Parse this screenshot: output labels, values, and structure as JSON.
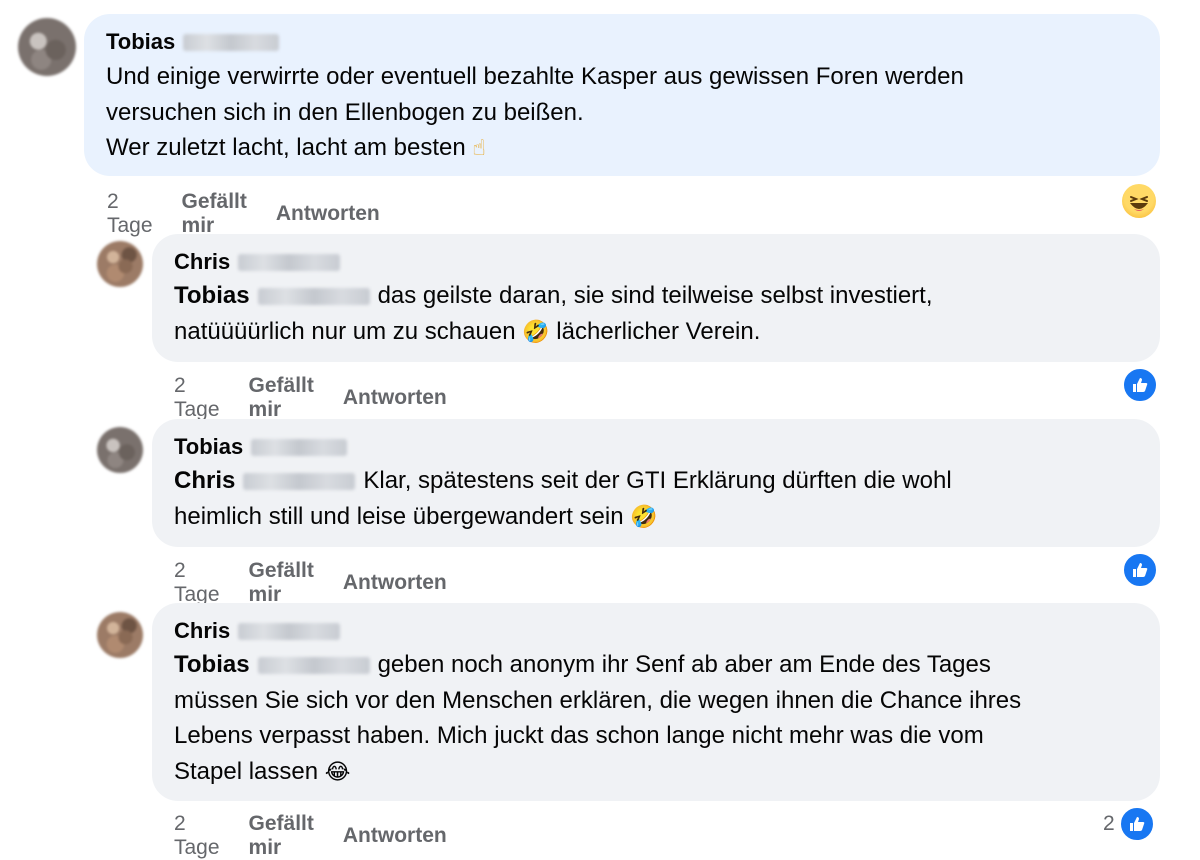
{
  "comments": [
    {
      "author": "Tobias",
      "text_lines": [
        "Und einige verwirrte oder eventuell bezahlte Kasper aus gewissen Foren werden",
        "versuchen sich in den Ellenbogen zu beißen.",
        "Wer zuletzt lacht, lacht am besten"
      ],
      "emoji": "☝",
      "time": "2 Tage",
      "like_label": "Gefällt mir",
      "reply_label": "Antworten",
      "reaction": "haha-emoji"
    },
    {
      "author": "Chris",
      "mention": "Tobias",
      "text_lines": [
        "das geilste daran, sie sind teilweise selbst investiert,",
        "natüüüürlich nur um zu schauen"
      ],
      "emoji": "🤣",
      "text_after_emoji": "lächerlicher Verein.",
      "time": "2 Tage",
      "like_label": "Gefällt mir",
      "reply_label": "Antworten",
      "reaction": "like"
    },
    {
      "author": "Tobias",
      "mention": "Chris",
      "text_lines": [
        "Klar, spätestens seit der GTI Erklärung dürften die wohl",
        "heimlich still und leise übergewandert sein"
      ],
      "emoji": "🤣",
      "time": "2 Tage",
      "like_label": "Gefällt mir",
      "reply_label": "Antworten",
      "reaction": "like"
    },
    {
      "author": "Chris",
      "mention": "Tobias",
      "text_lines": [
        "geben noch anonym ihr Senf ab aber am Ende des Tages",
        "müssen Sie sich vor den Menschen erklären, die wegen ihnen die Chance ihres",
        "Lebens verpasst haben. Mich juckt das schon lange nicht mehr was die vom",
        "Stapel lassen"
      ],
      "emoji": "😂",
      "time": "2 Tage",
      "like_label": "Gefällt mir",
      "reply_label": "Antworten",
      "reaction": "like",
      "reaction_count": "2"
    }
  ],
  "colors": {
    "highlight_bubble": "#e9f2fe",
    "bubble": "#f0f2f5",
    "like_blue": "#1877f2",
    "meta_text": "#65676b"
  }
}
